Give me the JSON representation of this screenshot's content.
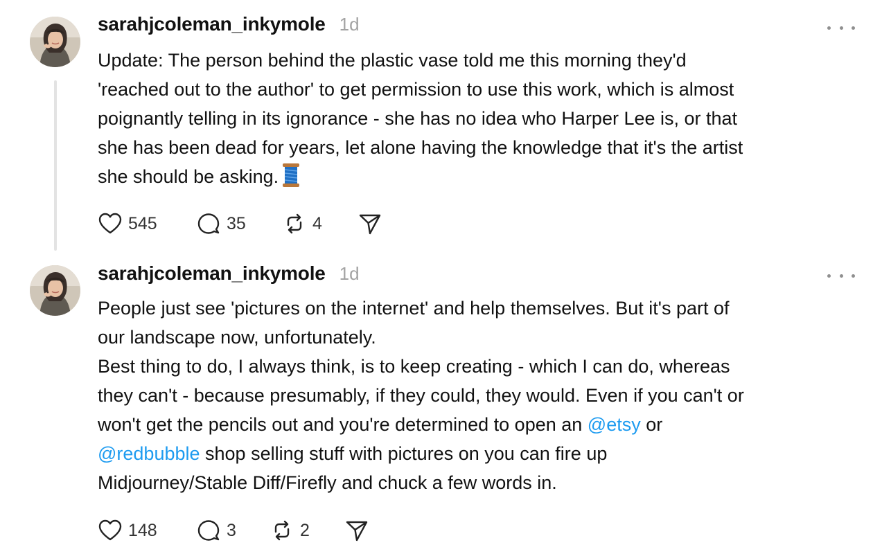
{
  "posts": [
    {
      "username": "sarahjcoleman_inkymole",
      "timestamp": "1d",
      "body_lines": [
        "Update: The person behind the plastic vase told me this morning they'd",
        "'reached out to the author' to get permission to use this work, which is almost",
        "poignantly telling in its ignorance - she has no idea who Harper Lee is, or that",
        "she has been dead for years, let alone having the knowledge that it's the artist",
        "she should be asking."
      ],
      "emoji_icon": "thread-spool-icon",
      "likes": "545",
      "replies": "35",
      "reposts": "4"
    },
    {
      "username": "sarahjcoleman_inkymole",
      "timestamp": "1d",
      "body_lines": [
        "People just see 'pictures on the internet' and help themselves. But it's part of",
        "our landscape now, unfortunately.",
        "Best thing to do, I always think, is to keep creating - which I can do, whereas",
        "they can't - because presumably, if they could, they would. Even if you can't or"
      ],
      "line5_before": "won't get the pencils out and you're determined to open an ",
      "mention_1": "@etsy",
      "line5_after": " or",
      "mention_2": "@redbubble",
      "line6_after": " shop selling stuff with pictures on you can fire up",
      "line7": "Midjourney/Stable Diff/Firefly and chuck a few words in.",
      "likes": "148",
      "replies": "3",
      "reposts": "2"
    }
  ],
  "colors": {
    "mention": "#1d9bf0",
    "timestamp": "#a3a3a3",
    "thread_line": "#e3e3e3"
  },
  "icons": [
    "heart-icon",
    "comment-icon",
    "repost-icon",
    "share-icon",
    "more-options-icon",
    "thread-spool-icon"
  ]
}
